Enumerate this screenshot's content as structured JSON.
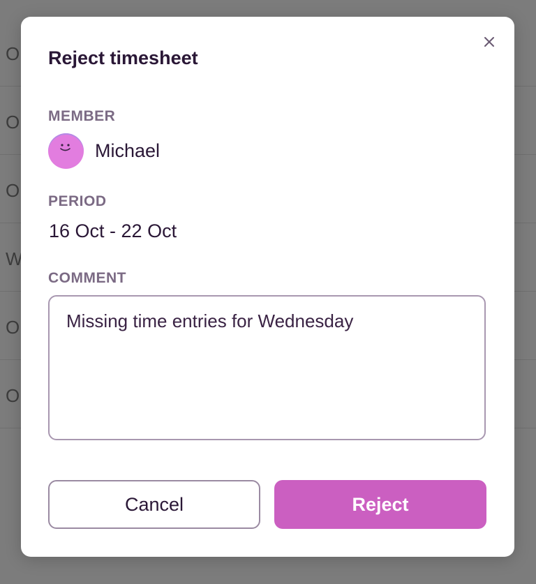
{
  "background": {
    "rows": [
      "O",
      "O",
      "O",
      "W",
      "O",
      "O"
    ]
  },
  "dialog": {
    "title": "Reject timesheet",
    "close_icon": "close-icon",
    "member_label": "MEMBER",
    "member_name": "Michael",
    "avatar_icon": "smiley-avatar",
    "period_label": "PERIOD",
    "period_value": "16 Oct - 22 Oct",
    "comment_label": "COMMENT",
    "comment_value": "Missing time entries for Wednesday",
    "cancel_label": "Cancel",
    "reject_label": "Reject"
  },
  "colors": {
    "accent": "#cb5fc1",
    "avatar": "#e27ddf",
    "text_dark": "#2a1736",
    "label_muted": "#7b6a84"
  }
}
